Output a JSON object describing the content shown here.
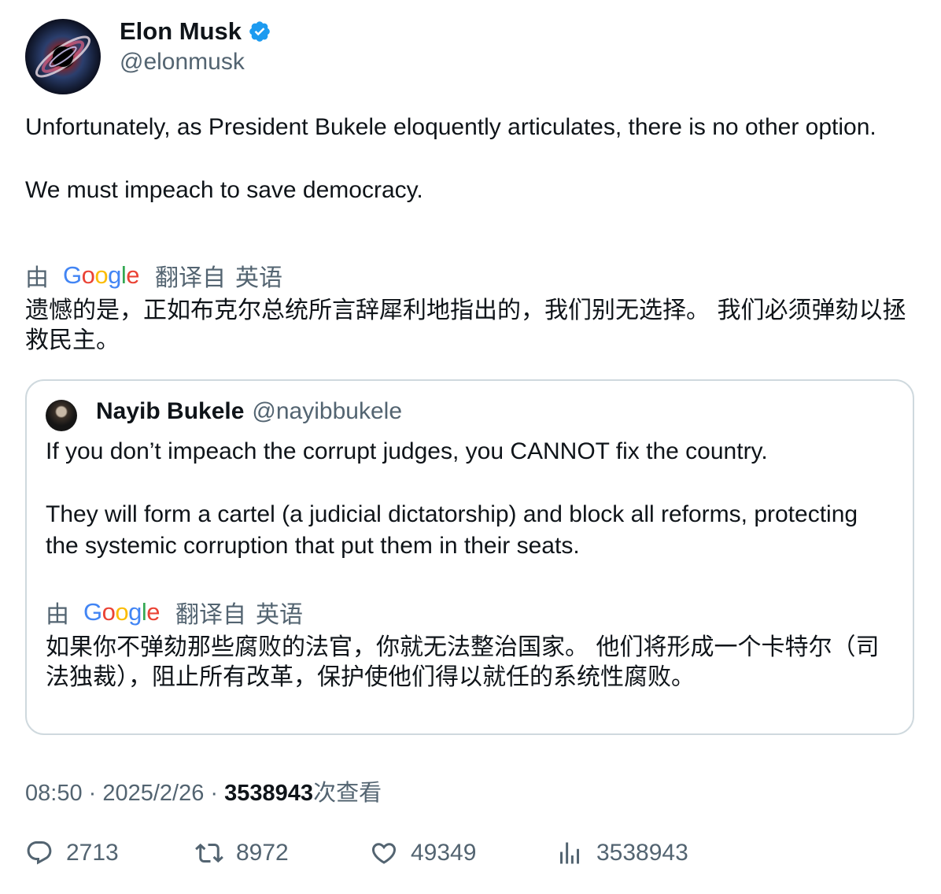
{
  "author": {
    "display_name": "Elon Musk",
    "handle": "@elonmusk",
    "verified_color": "#1d9bf0"
  },
  "tweet": {
    "text": "Unfortunately, as President Bukele eloquently articulates, there is no other option.\n\nWe must impeach to save democracy.",
    "translation_label": {
      "by": "由",
      "provider": "Google",
      "from": "翻译自",
      "language": "英语"
    },
    "translated_text": "遗憾的是，正如布克尔总统所言辞犀利地指出的，我们别无选择。 我们必须弹劾以拯救民主。"
  },
  "quote": {
    "display_name": "Nayib Bukele",
    "handle": "@nayibbukele",
    "text": "If you don’t impeach the corrupt judges, you CANNOT fix the country.\n\nThey will form a cartel (a judicial dictatorship) and block all reforms, protecting the systemic corruption that put them in their seats.",
    "translation_label": {
      "by": "由",
      "provider": "Google",
      "from": "翻译自",
      "language": "英语"
    },
    "translated_text": "如果你不弹劾那些腐败的法官，你就无法整治国家。 他们将形成一个卡特尔（司法独裁），阻止所有改革，保护使他们得以就任的系统性腐败。"
  },
  "meta": {
    "time": "08:50",
    "separator": " · ",
    "date": "2025/2/26",
    "views_count": "3538943",
    "views_suffix": "次查看"
  },
  "actions": {
    "replies": "2713",
    "retweets": "8972",
    "likes": "49349",
    "views": "3538943"
  },
  "colors": {
    "text_primary": "#0f1419",
    "text_secondary": "#536471",
    "border": "#cfd9de",
    "google_blue": "#4285f4",
    "google_red": "#ea4335",
    "google_yellow": "#fbbc05",
    "google_green": "#34a853"
  }
}
